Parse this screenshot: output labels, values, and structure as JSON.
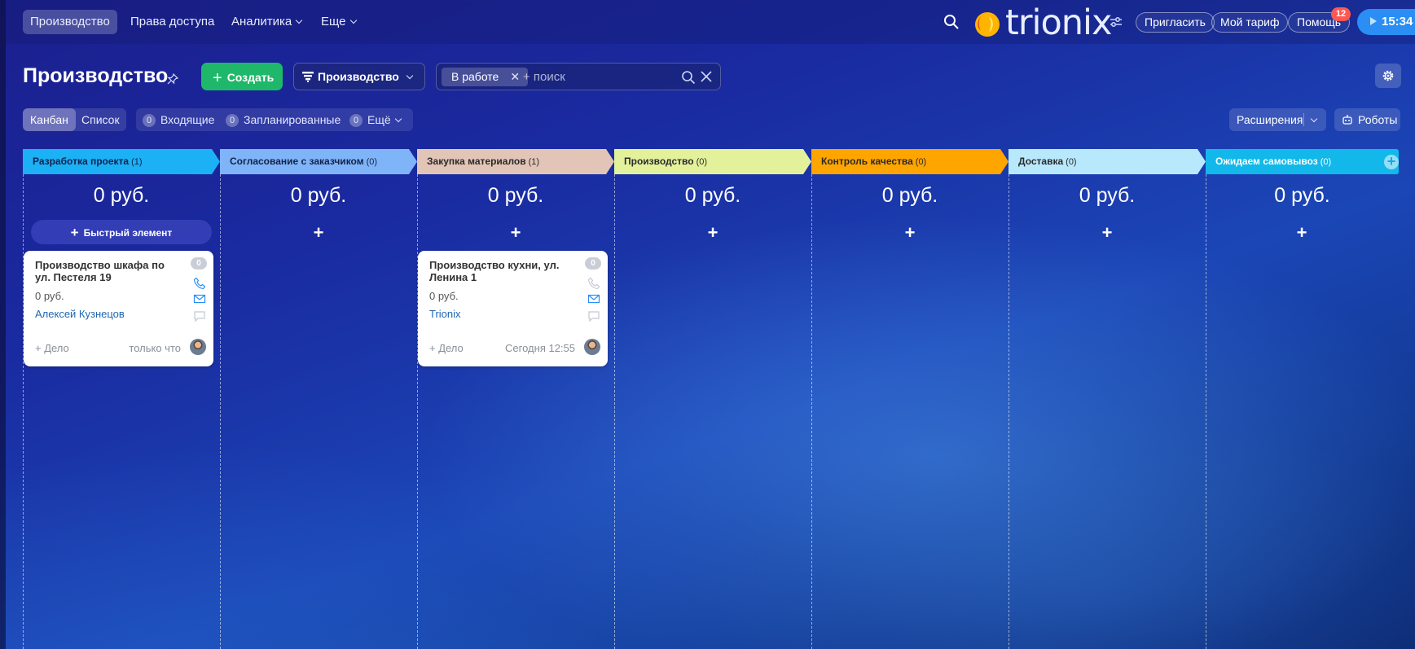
{
  "nav": {
    "items": [
      {
        "label": "Производство",
        "active": true
      },
      {
        "label": "Права доступа"
      },
      {
        "label": "Аналитика",
        "dropdown": true
      },
      {
        "label": "Еще",
        "dropdown": true
      }
    ],
    "logo_text": "trionix",
    "invite": "Пригласить",
    "tariff": "Мой тариф",
    "help": "Помощь",
    "help_badge": "12",
    "time": "15:34"
  },
  "toolbar": {
    "title": "Производство",
    "create": "Создать",
    "funnel": "Производство",
    "filter_chip": "В работе",
    "search_placeholder": "+ поиск"
  },
  "view": {
    "kanban": "Канбан",
    "list": "Список",
    "counters": [
      {
        "count": "0",
        "label": "Входящие"
      },
      {
        "count": "0",
        "label": "Запланированные"
      },
      {
        "count": "0",
        "label": "Ещё"
      }
    ],
    "extensions": "Расширения",
    "robots": "Роботы"
  },
  "columns": [
    {
      "title": "Разработка проекта",
      "count": "(1)",
      "color": "#1cb0f5",
      "text_color": "#12224a",
      "sum": "0 руб."
    },
    {
      "title": "Согласование с заказчиком",
      "count": "(0)",
      "color": "#7fb4f8",
      "text_color": "#12224a",
      "sum": "0 руб."
    },
    {
      "title": "Закупка материалов",
      "count": "(1)",
      "color": "#e2c5b6",
      "text_color": "#2a2a2a",
      "sum": "0 руб."
    },
    {
      "title": "Производство",
      "count": "(0)",
      "color": "#e3f29a",
      "text_color": "#2a2a2a",
      "sum": "0 руб."
    },
    {
      "title": "Контроль качества",
      "count": "(0)",
      "color": "#ffa500",
      "text_color": "#2a2a2a",
      "sum": "0 руб."
    },
    {
      "title": "Доставка",
      "count": "(0)",
      "color": "#b8e8fc",
      "text_color": "#2a2a2a",
      "sum": "0 руб."
    },
    {
      "title": "Ожидаем самовывоз",
      "count": "(0)",
      "color": "#12b8ea",
      "text_color": "#ffffff",
      "sum": "0 руб."
    }
  ],
  "quick_add": "Быстрый элемент",
  "cards": [
    {
      "title": "Производство шкафа по ул. Пестеля 19",
      "sum": "0 руб.",
      "client": "Алексей Кузнецов",
      "add": "+ Дело",
      "time": "только что",
      "badge": "0"
    },
    {
      "title": "Производство кухни, ул. Ленина 1",
      "sum": "0 руб.",
      "client": "Trionix",
      "add": "+ Дело",
      "time": "Сегодня 12:55",
      "badge": "0"
    }
  ]
}
